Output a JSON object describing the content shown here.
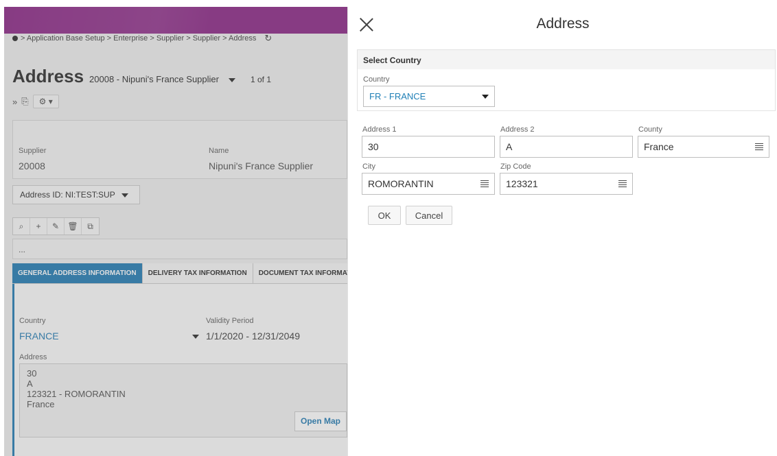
{
  "background": {
    "breadcrumb": "> Application Base Setup > Enterprise > Supplier > Supplier > Address",
    "title": "Address",
    "record": "20008 - Nipuni's France Supplier",
    "count": "1 of 1",
    "supplier_label": "Supplier",
    "supplier_value": "20008",
    "name_label": "Name",
    "name_value": "Nipuni's France Supplier",
    "address_id": "Address ID: NI:TEST:SUP",
    "ellipsis": "...",
    "tabs": [
      {
        "label": "GENERAL ADDRESS INFORMATION"
      },
      {
        "label": "DELIVERY TAX INFORMATION"
      },
      {
        "label": "DOCUMENT TAX INFORMAT"
      }
    ],
    "country_label": "Country",
    "country_value": "FRANCE",
    "validity_label": "Validity Period",
    "validity_value": "1/1/2020 - 12/31/2049",
    "address_label": "Address",
    "address_lines": [
      "30",
      "A",
      "123321 - ROMORANTIN",
      "France"
    ],
    "open_map": "Open Map"
  },
  "dialog": {
    "title": "Address",
    "select_country_header": "Select Country",
    "country_label": "Country",
    "country_value": "FR - FRANCE",
    "address1_label": "Address 1",
    "address1_value": "30",
    "address2_label": "Address 2",
    "address2_value": "A",
    "county_label": "County",
    "county_value": "France",
    "city_label": "City",
    "city_value": "ROMORANTIN",
    "zip_label": "Zip Code",
    "zip_value": "123321",
    "ok_label": "OK",
    "cancel_label": "Cancel"
  },
  "colors": {
    "accent": "#2a7fb5",
    "topbar": "#8f2e8a",
    "link": "#1f7fb6"
  }
}
